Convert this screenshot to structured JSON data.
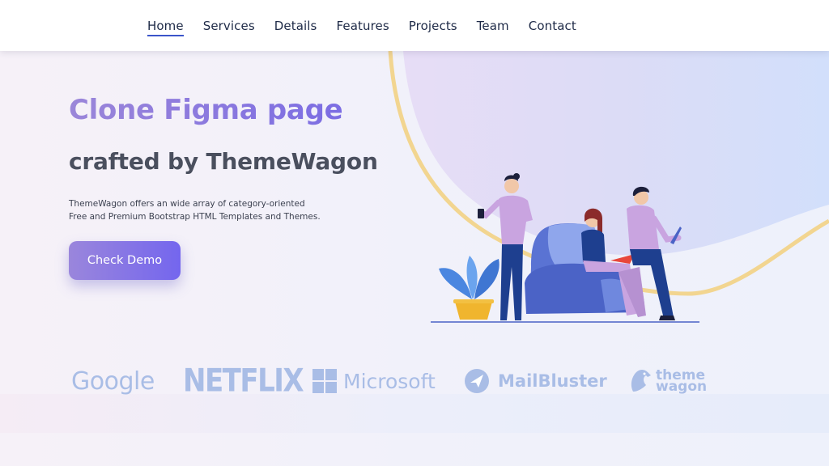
{
  "nav": {
    "items": [
      {
        "label": "Home",
        "active": true
      },
      {
        "label": "Services",
        "active": false
      },
      {
        "label": "Details",
        "active": false
      },
      {
        "label": "Features",
        "active": false
      },
      {
        "label": "Projects",
        "active": false
      },
      {
        "label": "Team",
        "active": false
      },
      {
        "label": "Contact",
        "active": false
      }
    ]
  },
  "hero": {
    "title": "Clone Figma page",
    "subtitle": "crafted by ThemeWagon",
    "description_line1": "ThemeWagon offers an wide array of category-oriented",
    "description_line2": "Free and Premium Bootstrap HTML Templates and Themes.",
    "cta_label": "Check Demo"
  },
  "logos": {
    "google": "Google",
    "netflix": "NETFLIX",
    "microsoft": "Microsoft",
    "mailbluster": "MailBluster",
    "themewagon_line1": "theme",
    "themewagon_line2": "wagon"
  },
  "colors": {
    "accent_start": "#9a86dc",
    "accent_end": "#7466ee",
    "nav_active_underline": "#3b55c9",
    "logo_tint": "#a9bde6",
    "curve_gold": "#f2d590"
  },
  "icons": [
    "illustration-people-sofa",
    "mailbluster-logo-icon",
    "themewagon-horse-icon",
    "microsoft-grid-icon"
  ]
}
